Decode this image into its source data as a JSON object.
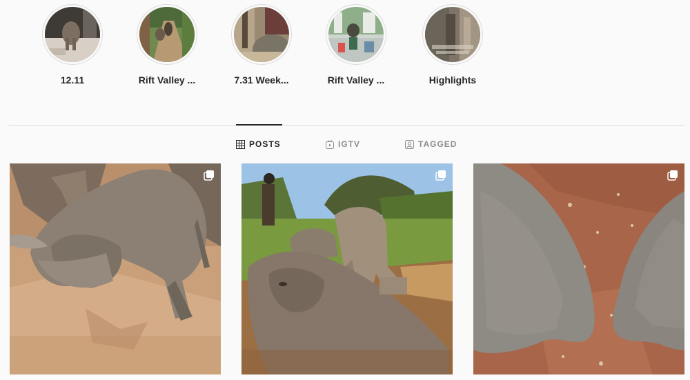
{
  "highlights": [
    {
      "label": "12.11",
      "icon": "highlight-cover"
    },
    {
      "label": "Rift Valley ...",
      "icon": "highlight-cover"
    },
    {
      "label": "7.31 Week...",
      "icon": "highlight-cover"
    },
    {
      "label": "Rift Valley ...",
      "icon": "highlight-cover"
    },
    {
      "label": "Highlights",
      "icon": "highlight-cover"
    }
  ],
  "tabs": {
    "posts": {
      "label": "POSTS",
      "icon": "grid-icon",
      "active": true
    },
    "igtv": {
      "label": "IGTV",
      "icon": "igtv-icon",
      "active": false
    },
    "tagged": {
      "label": "TAGGED",
      "icon": "tagged-icon",
      "active": false
    }
  },
  "posts": [
    {
      "description": "post-elephant-calf-dirt",
      "icon": "multiple-posts-icon"
    },
    {
      "description": "post-elephants-mud-bath",
      "icon": "multiple-posts-icon"
    },
    {
      "description": "post-elephant-ears",
      "icon": "multiple-posts-icon"
    }
  ],
  "colors": {
    "text": "#262626",
    "muted": "#8e8e8e",
    "border": "#dbdbdb",
    "background": "#fafafa"
  }
}
